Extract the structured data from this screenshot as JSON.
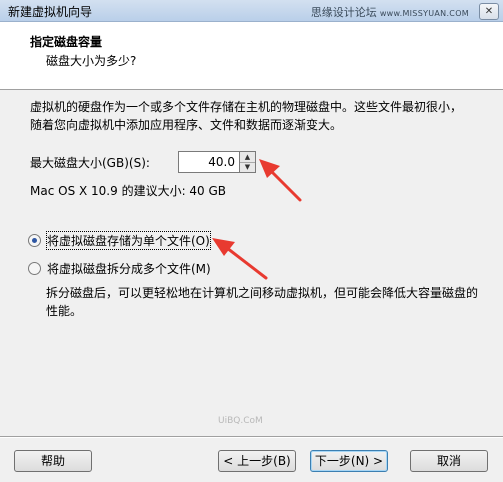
{
  "window": {
    "title": "新建虚拟机向导",
    "watermark_text": "思缘设计论坛",
    "watermark_site": "www.MISSYUAN.COM",
    "close_glyph": "✕"
  },
  "header": {
    "title": "指定磁盘容量",
    "subtitle": "磁盘大小为多少?"
  },
  "content": {
    "description": "虚拟机的硬盘作为一个或多个文件存储在主机的物理磁盘中。这些文件最初很小，随着您向虚拟机中添加应用程序、文件和数据而逐渐变大。",
    "max_size_label": "最大磁盘大小(GB)(S):",
    "max_size_value": "40.0",
    "recommended": "Mac OS X 10.9 的建议大小: 40 GB",
    "options": [
      {
        "label": "将虚拟磁盘存储为单个文件(O)",
        "selected": true
      },
      {
        "label": "将虚拟磁盘拆分成多个文件(M)",
        "selected": false
      }
    ],
    "split_description": "拆分磁盘后，可以更轻松地在计算机之间移动虚拟机，但可能会降低大容量磁盘的性能。",
    "bottom_watermark": "UiBQ.CoM"
  },
  "icons": {
    "spin_up": "▲",
    "spin_down": "▼"
  },
  "colors": {
    "annotation_arrow": "#e83a30",
    "radio_selected": "#2f57a3",
    "default_button_border": "#3c7fb1"
  },
  "buttons": {
    "help": "帮助",
    "back": "< 上一步(B)",
    "next": "下一步(N) >",
    "cancel": "取消"
  }
}
